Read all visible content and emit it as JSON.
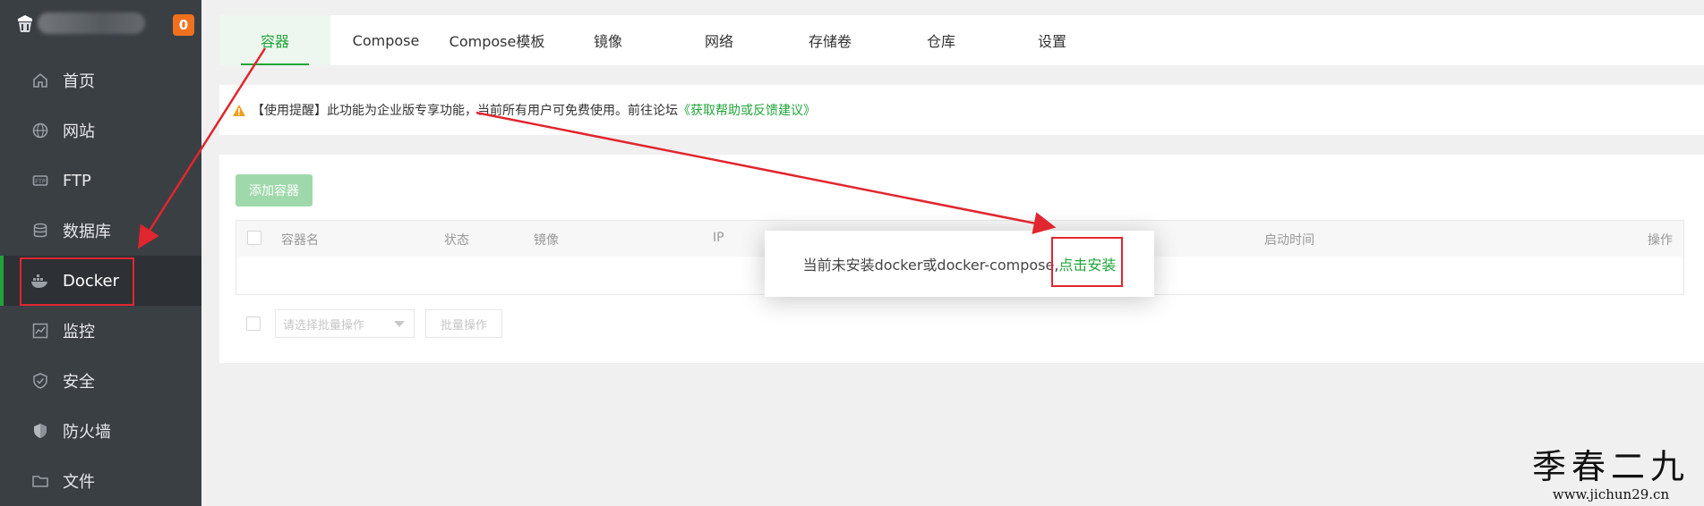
{
  "sidebar": {
    "badge": "0",
    "items": [
      {
        "label": "首页",
        "icon": "home-icon"
      },
      {
        "label": "网站",
        "icon": "globe-icon"
      },
      {
        "label": "FTP",
        "icon": "ftp-icon"
      },
      {
        "label": "数据库",
        "icon": "database-icon"
      },
      {
        "label": "Docker",
        "icon": "docker-icon"
      },
      {
        "label": "监控",
        "icon": "monitor-icon"
      },
      {
        "label": "安全",
        "icon": "shield-icon"
      },
      {
        "label": "防火墙",
        "icon": "firewall-icon"
      },
      {
        "label": "文件",
        "icon": "folder-icon"
      }
    ],
    "active_index": 4
  },
  "tabs": [
    {
      "label": "容器"
    },
    {
      "label": "Compose"
    },
    {
      "label": "Compose模板"
    },
    {
      "label": "镜像"
    },
    {
      "label": "网络"
    },
    {
      "label": "存储卷"
    },
    {
      "label": "仓库"
    },
    {
      "label": "设置"
    }
  ],
  "notice": {
    "text": "【使用提醒】此功能为企业版专享功能，当前所有用户可免费使用。前往论坛",
    "link": "《获取帮助或反馈建议》"
  },
  "container": {
    "add_button": "添加容器",
    "columns": [
      "容器名",
      "状态",
      "镜像",
      "IP",
      "启动时间",
      "操作"
    ],
    "batch_placeholder": "请选择批量操作",
    "batch_button": "批量操作"
  },
  "modal": {
    "text": "当前未安装docker或docker-compose,",
    "install_link": "点击安装"
  },
  "watermark": {
    "name": "季春二九",
    "url": "www.jichun29.cn"
  },
  "colors": {
    "accent": "#20a53a",
    "sidebar_bg": "#3a3f44",
    "badge": "#f0701e",
    "annotation_red": "#e0262e"
  }
}
